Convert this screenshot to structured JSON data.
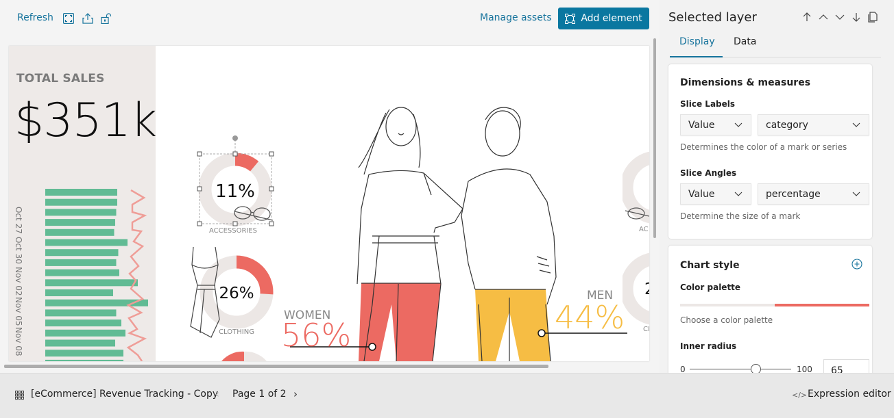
{
  "toolbar": {
    "refresh_label": "Refresh",
    "icons": [
      "fullscreen-icon",
      "share-icon",
      "unlock-icon"
    ],
    "manage_assets_label": "Manage assets",
    "add_element_label": "Add element"
  },
  "canvas": {
    "total_sales": {
      "label": "TOTAL SALES",
      "value": "$351k"
    },
    "date_axis_labels": [
      "Oct 27",
      "Oct 30",
      "Nov 02",
      "Nov 05",
      "Nov 08"
    ],
    "bar_colors": {
      "bar": "#61bb94",
      "line": "#ef9d97"
    },
    "donuts": [
      {
        "label": "ACCESSORIES",
        "percent_text": "11%",
        "percent": 11,
        "selected": true
      },
      {
        "label": "CLOTHING",
        "percent_text": "26%",
        "percent": 26,
        "selected": false
      }
    ],
    "gender": {
      "women": {
        "label": "WOMEN",
        "percent_text": "56%",
        "color": "#ec6a62"
      },
      "men": {
        "label": "MEN",
        "percent_text": "44%",
        "color": "#f6bd44"
      }
    },
    "colors": {
      "accent_red": "#ec6a62",
      "donut_track": "#ece7e5",
      "left_panel_bg": "#eeeae8"
    }
  },
  "right_panel": {
    "title": "Selected layer",
    "actions": [
      "move-top-icon",
      "move-up-icon",
      "move-down-icon",
      "move-bottom-icon",
      "duplicate-icon"
    ],
    "tabs": [
      {
        "label": "Display",
        "active": true
      },
      {
        "label": "Data",
        "active": false
      }
    ],
    "dimensions": {
      "title": "Dimensions & measures",
      "slice_labels": {
        "label": "Slice Labels",
        "type_value": "Value",
        "field_value": "category",
        "hint": "Determines the color of a mark or series"
      },
      "slice_angles": {
        "label": "Slice Angles",
        "type_value": "Value",
        "field_value": "percentage",
        "hint": "Determine the size of a mark"
      }
    },
    "chart_style": {
      "title": "Chart style",
      "color_palette_label": "Color palette",
      "color_palette_hint": "Choose a color palette",
      "palette_colors": [
        "#ece7e5",
        "#ec6a62"
      ],
      "inner_radius_label": "Inner radius",
      "inner_radius_min": "0",
      "inner_radius_max": "100",
      "inner_radius_value": "65",
      "inner_radius_fraction": 0.65
    }
  },
  "bottom_bar": {
    "workpad_name": "[eCommerce] Revenue Tracking - Copy",
    "page_label": "Page 1 of 2",
    "expression_editor_label": "Expression editor"
  },
  "accent_color": "#0a77a0"
}
